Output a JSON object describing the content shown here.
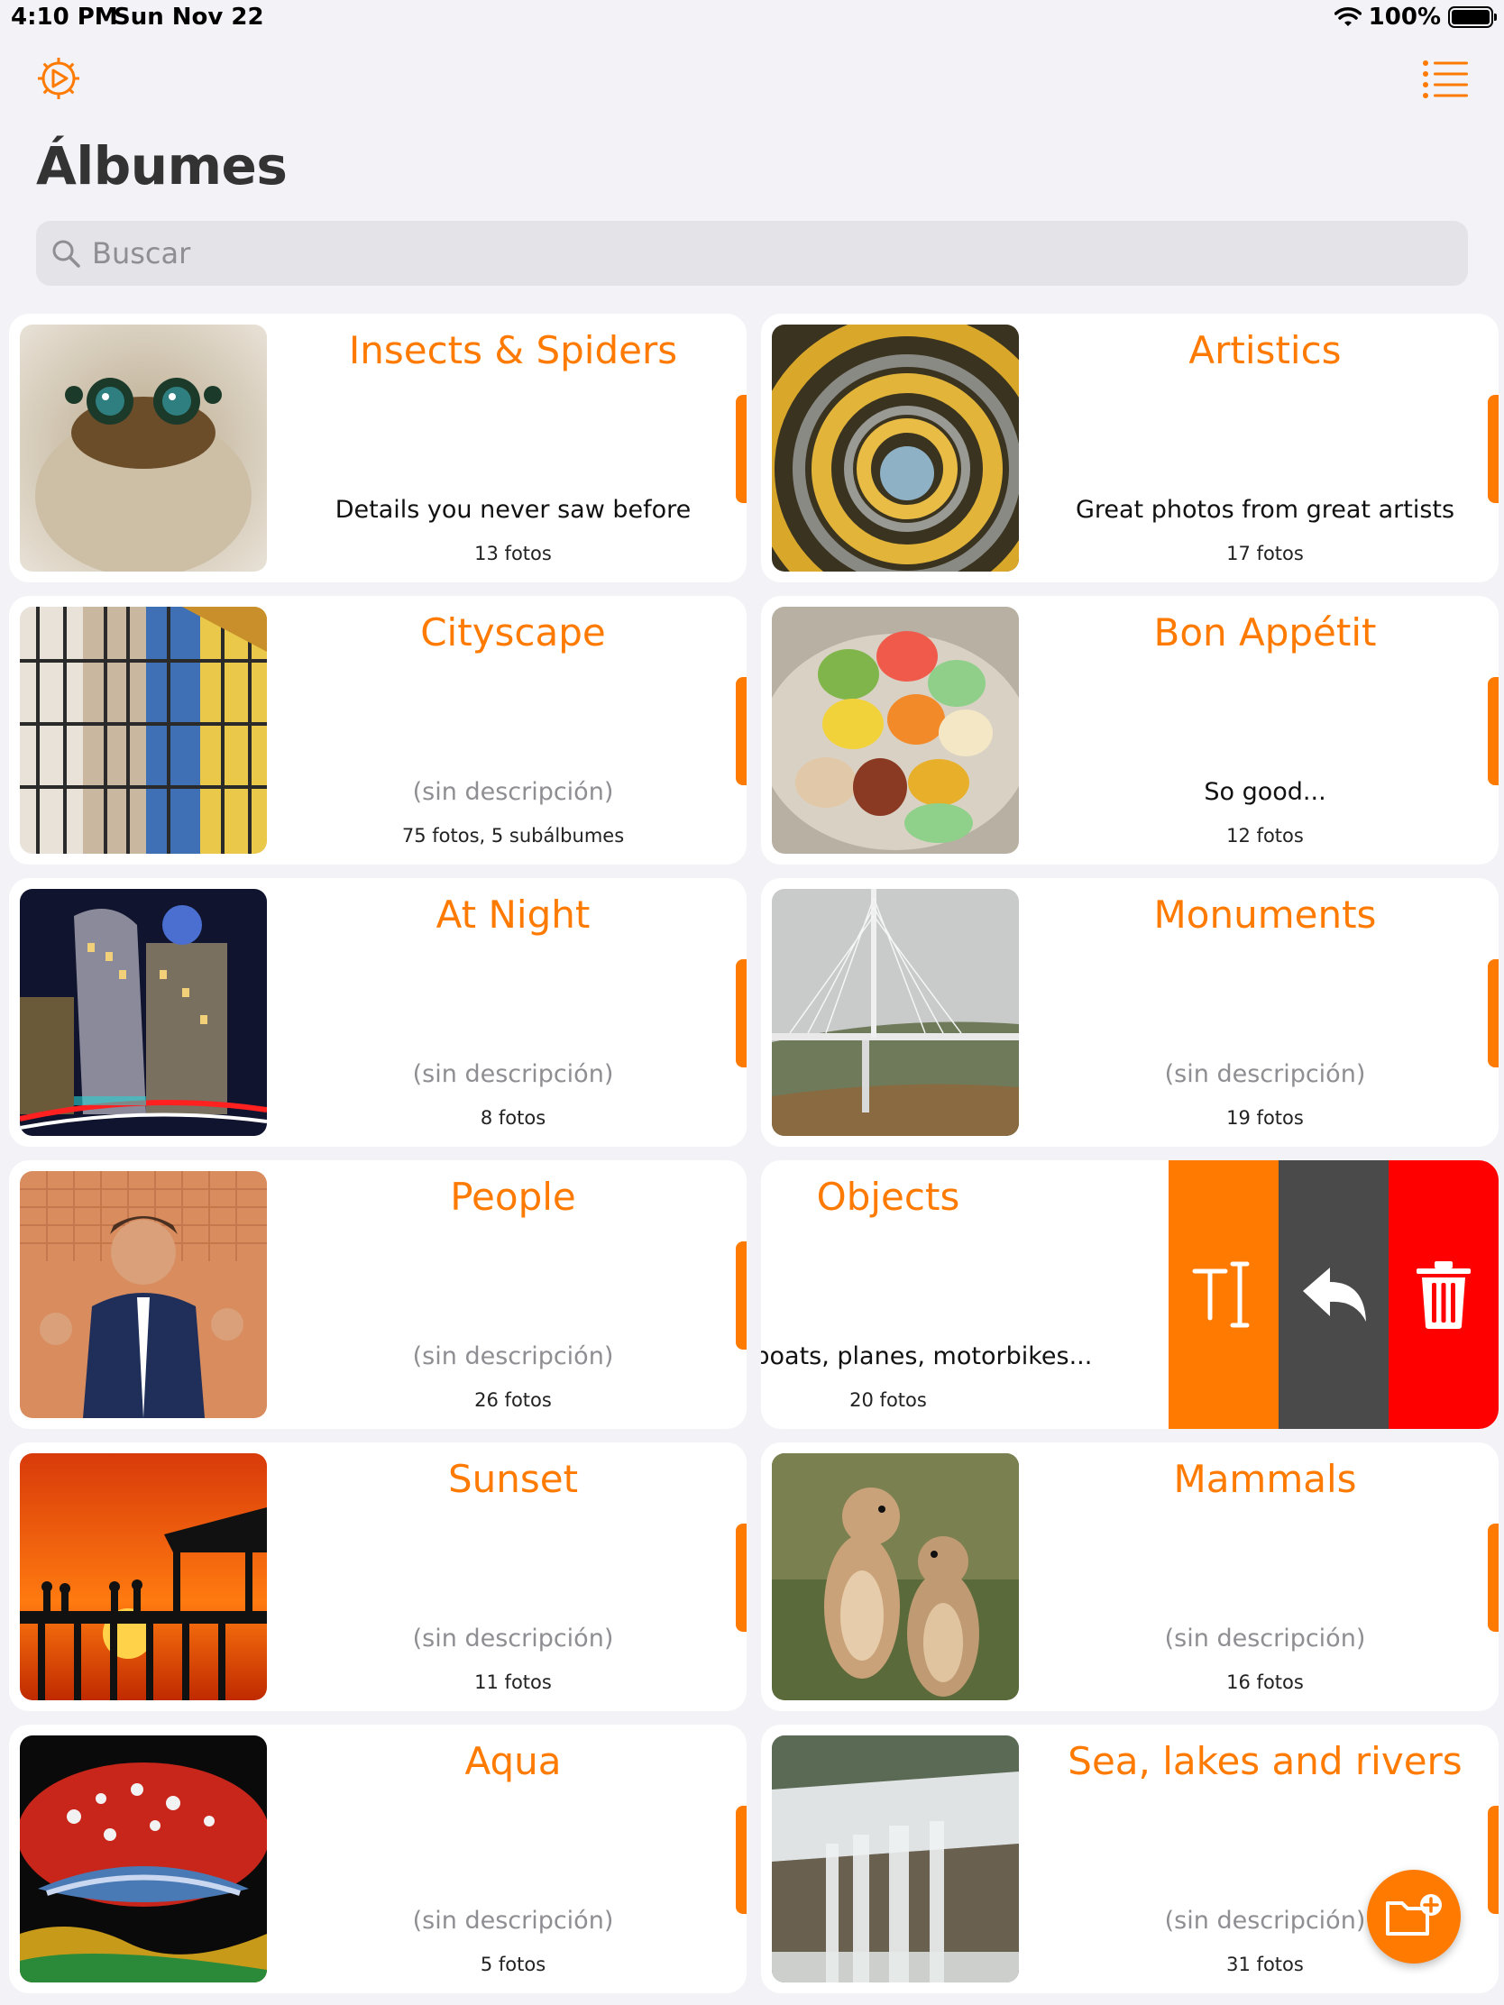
{
  "status_bar": {
    "time": "4:10 PM",
    "date": "Sun Nov 22",
    "battery": "100%"
  },
  "header": {
    "title": "Álbumes",
    "settings_icon": "settings-icon",
    "view_toggle_icon": "list-view-icon"
  },
  "search": {
    "placeholder": "Buscar",
    "value": ""
  },
  "colors": {
    "accent": "#ff7a00",
    "move": "#4a4a4a",
    "delete": "#ff0000"
  },
  "albums": [
    {
      "title": "Insects & Spiders",
      "description": "Details you never saw before",
      "count": "13 fotos"
    },
    {
      "title": "Artistics",
      "description": "Great photos from great artists",
      "count": "17 fotos"
    },
    {
      "title": "Cityscape",
      "description": "(sin descripción)",
      "count": "75 fotos, 5 subálbumes"
    },
    {
      "title": "Bon Appétit",
      "description": "So good...",
      "count": "12 fotos"
    },
    {
      "title": "At Night",
      "description": "(sin descripción)",
      "count": "8 fotos"
    },
    {
      "title": "Monuments",
      "description": "(sin descripción)",
      "count": "19 fotos"
    },
    {
      "title": "People",
      "description": "(sin descripción)",
      "count": "26 fotos"
    },
    {
      "title": "Objects",
      "description": "Cars, boats, planes, motorbikes...",
      "count": "20 fotos"
    },
    {
      "title": "Sunset",
      "description": "(sin descripción)",
      "count": "11 fotos"
    },
    {
      "title": "Mammals",
      "description": "(sin descripción)",
      "count": "16 fotos"
    },
    {
      "title": "Aqua",
      "description": "(sin descripción)",
      "count": "5 fotos"
    },
    {
      "title": "Sea, lakes and rivers",
      "description": "(sin descripción)",
      "count": "31 fotos"
    }
  ],
  "swipe_actions": [
    "rename-icon",
    "move-icon",
    "trash-icon"
  ],
  "fab_icon": "add-album-icon"
}
